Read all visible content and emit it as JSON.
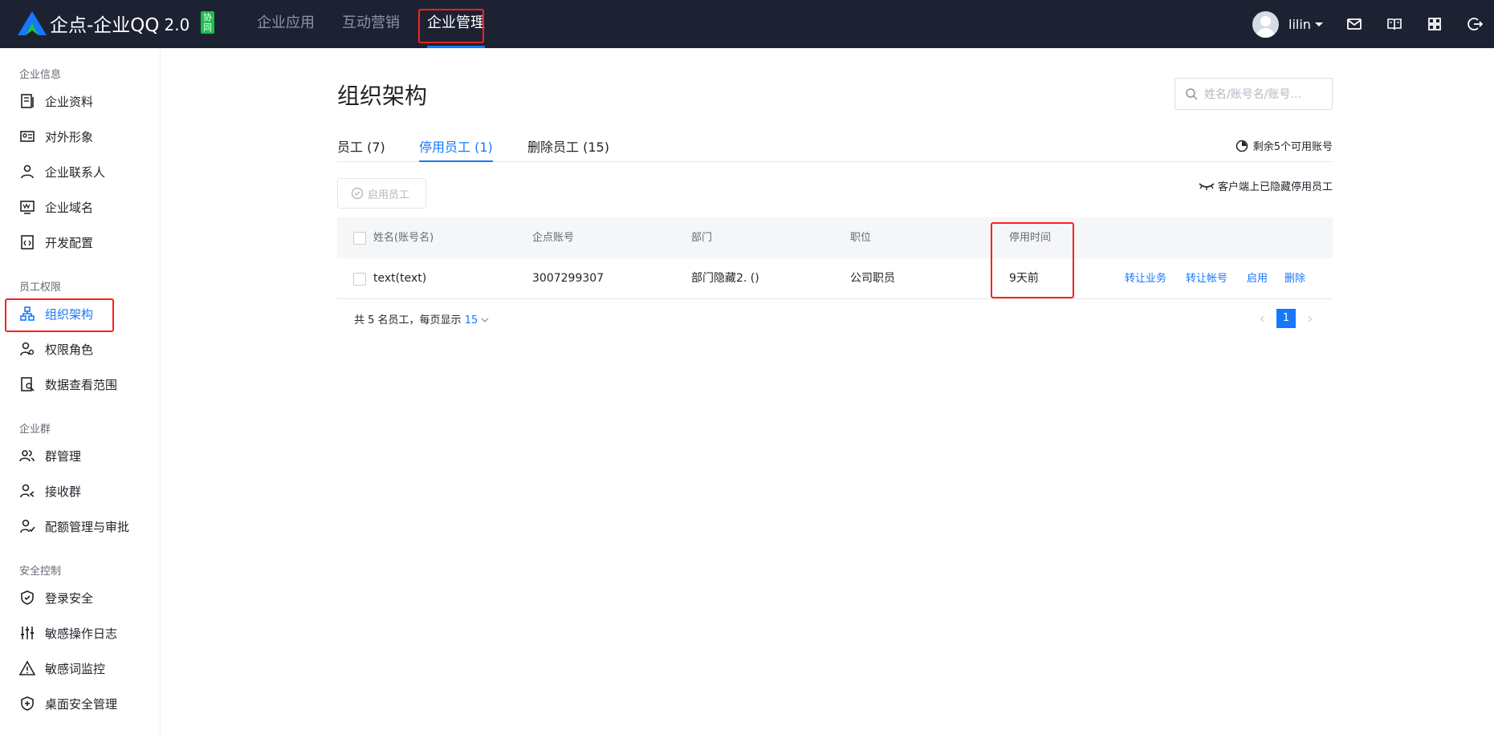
{
  "header": {
    "logo_title": "企点-企业QQ",
    "logo_version": "2.0",
    "logo_badge": "协同",
    "nav": [
      "企业应用",
      "互动营销",
      "企业管理"
    ],
    "active_nav": "企业管理",
    "username": "lilin"
  },
  "sidebar": {
    "groups": [
      {
        "title": "企业信息",
        "items": [
          {
            "label": "企业资料",
            "icon": "document-icon"
          },
          {
            "label": "对外形象",
            "icon": "id-card-icon"
          },
          {
            "label": "企业联系人",
            "icon": "contact-icon"
          },
          {
            "label": "企业域名",
            "icon": "domain-icon"
          },
          {
            "label": "开发配置",
            "icon": "code-icon"
          }
        ]
      },
      {
        "title": "员工权限",
        "items": [
          {
            "label": "组织架构",
            "icon": "org-chart-icon",
            "active": true
          },
          {
            "label": "权限角色",
            "icon": "role-icon"
          },
          {
            "label": "数据查看范围",
            "icon": "data-scope-icon"
          }
        ]
      },
      {
        "title": "企业群",
        "items": [
          {
            "label": "群管理",
            "icon": "group-icon"
          },
          {
            "label": "接收群",
            "icon": "receive-group-icon"
          },
          {
            "label": "配额管理与审批",
            "icon": "quota-approval-icon"
          }
        ]
      },
      {
        "title": "安全控制",
        "items": [
          {
            "label": "登录安全",
            "icon": "shield-icon"
          },
          {
            "label": "敏感操作日志",
            "icon": "sliders-icon"
          },
          {
            "label": "敏感词监控",
            "icon": "warning-icon"
          },
          {
            "label": "桌面安全管理",
            "icon": "shield-plus-icon"
          }
        ]
      }
    ]
  },
  "main": {
    "title": "组织架构",
    "search_placeholder": "姓名/账号名/账号...",
    "tabs": [
      "员工 (7)",
      "停用员工 (1)",
      "删除员工 (15)"
    ],
    "active_tab": 1,
    "quota_text": "剩余5个可用账号",
    "enable_button": "启用员工",
    "hidden_note": "客户端上已隐藏停用员工",
    "table": {
      "headers": [
        "姓名(账号名)",
        "企点账号",
        "部门",
        "职位",
        "停用时间"
      ],
      "rows": [
        {
          "name": "text(text)",
          "account": "3007299307",
          "dept": "部门隐藏2. ()",
          "position": "公司职员",
          "disabled_time": "9天前",
          "actions": [
            "转让业务",
            "转让帐号",
            "启用",
            "删除"
          ]
        }
      ]
    },
    "footer_prefix": "共 5 名员工，每页显示",
    "per_page": "15",
    "current_page": "1"
  },
  "colors": {
    "topbar": "#1d2233",
    "accent": "#1677ff",
    "highlight": "#ff1f1f",
    "badge": "#1cbf4a"
  }
}
